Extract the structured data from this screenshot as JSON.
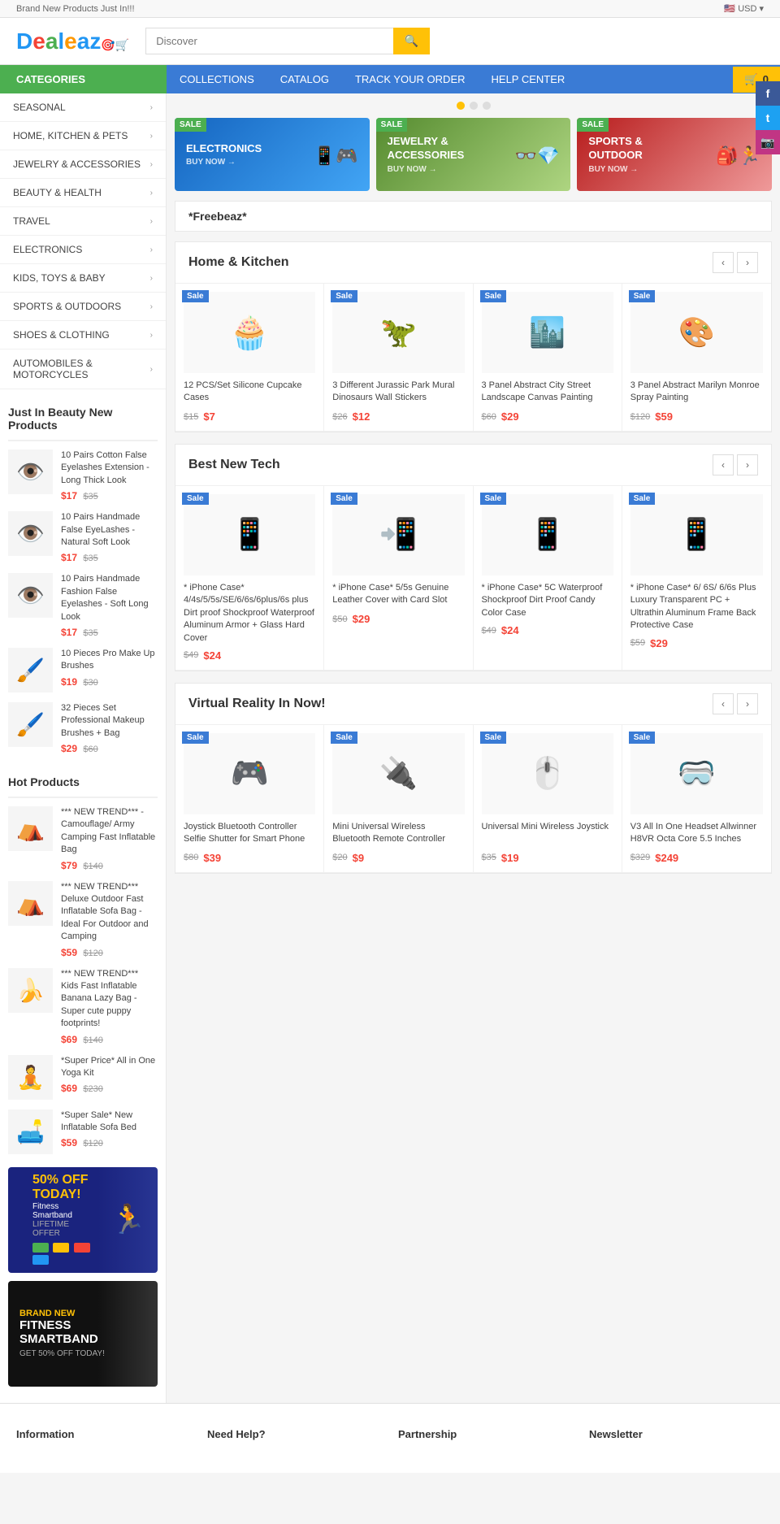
{
  "topbar": {
    "announcement": "Brand New Products Just In!!!",
    "currency": "USD"
  },
  "social": {
    "facebook": "f",
    "twitter": "t",
    "instagram": "ig"
  },
  "header": {
    "logo": "Dealeaz",
    "search_placeholder": "Discover",
    "search_btn": "🔍"
  },
  "navbar": {
    "categories_label": "CATEGORIES",
    "links": [
      "COLLECTIONS",
      "CATALOG",
      "TRACK YOUR ORDER",
      "HELP CENTER"
    ],
    "cart_label": "0"
  },
  "sidebar_categories": [
    {
      "label": "SEASONAL",
      "id": "seasonal"
    },
    {
      "label": "HOME, KITCHEN & PETS",
      "id": "home-kitchen"
    },
    {
      "label": "JEWELRY & ACCESSORIES",
      "id": "jewelry"
    },
    {
      "label": "BEAUTY & HEALTH",
      "id": "beauty"
    },
    {
      "label": "TRAVEL",
      "id": "travel"
    },
    {
      "label": "ELECTRONICS",
      "id": "electronics"
    },
    {
      "label": "KIDS, TOYS & BABY",
      "id": "kids"
    },
    {
      "label": "SPORTS & OUTDOORS",
      "id": "sports"
    },
    {
      "label": "SHOES & CLOTHING",
      "id": "shoes"
    },
    {
      "label": "AUTOMOBILES & MOTORCYCLES",
      "id": "automobiles"
    }
  ],
  "banners": [
    {
      "title": "ELECTRONICS",
      "subtitle": "BUY NOW →",
      "type": "electronics",
      "sale": true
    },
    {
      "title": "JEWELRY & ACCESSORIES",
      "subtitle": "BUY NOW →",
      "type": "jewelry",
      "sale": true
    },
    {
      "title": "SPORTS & OUTDOOR",
      "subtitle": "BUY NOW →",
      "type": "sports",
      "sale": true
    }
  ],
  "freebeaz": "*Freebeaz*",
  "sections": [
    {
      "id": "home-kitchen",
      "title": "Home & Kitchen",
      "products": [
        {
          "name": "12 PCS/Set Silicone Cupcake Cases",
          "price_old": "$15",
          "price_new": "$7",
          "sale": true,
          "icon": "cupcake-icon"
        },
        {
          "name": "3 Different Jurassic Park Mural Dinosaurs Wall Stickers",
          "price_old": "$26",
          "price_new": "$12",
          "sale": true,
          "icon": "dino-icon"
        },
        {
          "name": "3 Panel Abstract City Street Landscape Canvas Painting",
          "price_old": "$60",
          "price_new": "$29",
          "sale": true,
          "icon": "city-icon"
        },
        {
          "name": "3 Panel Abstract Marilyn Monroe Spray Painting",
          "price_old": "$120",
          "price_new": "$59",
          "sale": true,
          "icon": "marilyn-icon"
        }
      ]
    },
    {
      "id": "best-new-tech",
      "title": "Best New Tech",
      "products": [
        {
          "name": "* iPhone Case* 4/4s/5/5s/SE/6/6s/6plus/6s plus Dirt proof Shockproof Waterproof Aluminum Armor + Glass Hard Cover",
          "price_old": "$49",
          "price_new": "$24",
          "sale": true,
          "icon": "phone-icon"
        },
        {
          "name": "* iPhone Case* 5/5s Genuine Leather Cover with Card Slot",
          "price_old": "$50",
          "price_new": "$29",
          "sale": true,
          "icon": "iphone-icon"
        },
        {
          "name": "* iPhone Case* 5C Waterproof Shockproof Dirt Proof Candy Color Case",
          "price_old": "$49",
          "price_new": "$24",
          "sale": true,
          "icon": "cases-icon"
        },
        {
          "name": "* iPhone Case* 6/ 6S/ 6/6s Plus Luxury Transparent PC + Ultrathin Aluminum Frame Back Protective Case",
          "price_old": "$59",
          "price_new": "$29",
          "sale": true,
          "icon": "phone-icon"
        }
      ]
    },
    {
      "id": "virtual-reality",
      "title": "Virtual Reality In Now!",
      "products": [
        {
          "name": "Joystick Bluetooth Controller Selfie Shutter for Smart Phone",
          "price_old": "$80",
          "price_new": "$39",
          "sale": true,
          "icon": "joystick-icon"
        },
        {
          "name": "Mini Universal Wireless Bluetooth Remote Controller",
          "price_old": "$20",
          "price_new": "$9",
          "sale": true,
          "icon": "remote-icon"
        },
        {
          "name": "Universal Mini Wireless Joystick",
          "price_old": "$35",
          "price_new": "$19",
          "sale": true,
          "icon": "wireless-icon"
        },
        {
          "name": "V3 All In One Headset Allwinner H8VR Octa Core 5.5 Inches",
          "price_old": "$329",
          "price_new": "$249",
          "sale": true,
          "icon": "vr-icon"
        }
      ]
    }
  ],
  "just_in_beauty": {
    "title": "Just In Beauty New Products",
    "products": [
      {
        "name": "10 Pairs Cotton False Eyelashes Extension - Long Thick Look",
        "price_new": "$17",
        "price_old": "$35",
        "icon": "eyelash-icon"
      },
      {
        "name": "10 Pairs Handmade False EyeLashes - Natural Soft Look",
        "price_new": "$17",
        "price_old": "$35",
        "icon": "eyelash-icon"
      },
      {
        "name": "10 Pairs Handmade Fashion False Eyelashes - Soft Long Look",
        "price_new": "$17",
        "price_old": "$35",
        "icon": "eyelash-icon"
      },
      {
        "name": "10 Pieces Pro Make Up Brushes",
        "price_new": "$19",
        "price_old": "$30",
        "icon": "brush-icon"
      },
      {
        "name": "32 Pieces Set Professional Makeup Brushes + Bag",
        "price_new": "$29",
        "price_old": "$60",
        "icon": "brush-icon"
      }
    ]
  },
  "hot_products": {
    "title": "Hot Products",
    "products": [
      {
        "name": "*** NEW TREND*** - Camouflage/ Army Camping Fast Inflatable Bag",
        "price_new": "$79",
        "price_old": "$140",
        "icon": "camping-icon"
      },
      {
        "name": "*** NEW TREND*** Deluxe Outdoor Fast Inflatable Sofa Bag - Ideal For Outdoor and Camping",
        "price_new": "$59",
        "price_old": "$120",
        "icon": "camping-icon"
      },
      {
        "name": "*** NEW TREND*** Kids Fast Inflatable Banana Lazy Bag - Super cute puppy footprints!",
        "price_new": "$69",
        "price_old": "$140",
        "icon": "banana-icon"
      },
      {
        "name": "*Super Price* All in One Yoga Kit",
        "price_new": "$69",
        "price_old": "$230",
        "icon": "yoga-icon"
      },
      {
        "name": "*Super Sale* New Inflatable Sofa Bed",
        "price_new": "$59",
        "price_old": "$120",
        "icon": "sofa-icon"
      }
    ]
  },
  "promo_banners": [
    {
      "headline": "50% OFF TODAY!",
      "sub": "Fitness Smartband",
      "badge": "LIFETIME OFFER",
      "type": "50off"
    },
    {
      "headline": "BRAND NEW FITNESS SMARTBAND",
      "sub": "GET 50% OFF TODAY!",
      "badge": "",
      "type": "fitness"
    }
  ],
  "dots": [
    true,
    false,
    false
  ],
  "footer": {
    "cols": [
      {
        "title": "Information",
        "id": "info"
      },
      {
        "title": "Need Help?",
        "id": "help"
      },
      {
        "title": "Partnership",
        "id": "partnership"
      },
      {
        "title": "Newsletter",
        "id": "newsletter"
      }
    ]
  }
}
